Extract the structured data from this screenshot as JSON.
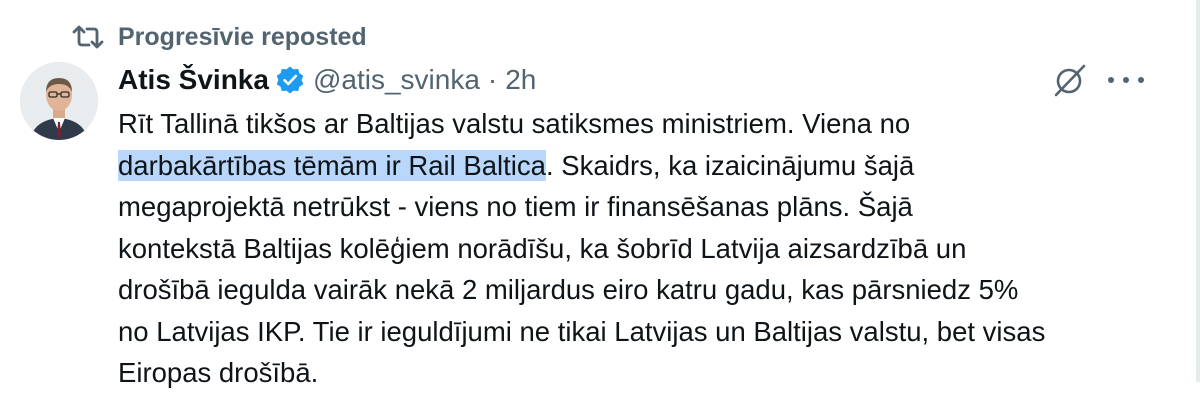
{
  "repost": {
    "icon": "repost-icon",
    "label": "Progresīvie reposted"
  },
  "author": {
    "avatar": "avatar",
    "name": "Atis Švinka",
    "verified_icon": "verified-badge-icon",
    "handle": "@atis_svinka",
    "separator": "·",
    "time": "2h"
  },
  "actions": {
    "grok_icon": "grok-icon",
    "more_icon": "more-options-icon"
  },
  "tweet": {
    "line1": "Rīt Tallinā tikšos ar Baltijas valstu satiksmes ministriem. Viena no",
    "line2_highlight": "darbakārtības tēmām ir Rail Baltica",
    "line2_rest": ". Skaidrs, ka izaicinājumu šajā",
    "line3": "megaprojektā netrūkst - viens no tiem ir finansēšanas plāns. Šajā",
    "line4": "kontekstā Baltijas kolēģiem norādīšu, ka šobrīd Latvija aizsardzībā un",
    "line5": "drošībā iegulda vairāk nekā 2 miljardus eiro katru gadu, kas pārsniedz 5%",
    "line6": "no Latvijas IKP. Tie ir ieguldījumi ne tikai Latvijas un Baltijas valstu, bet visas",
    "line7": "Eiropas drošībā."
  },
  "colors": {
    "text": "#0f1419",
    "secondary": "#536471",
    "verified": "#1d9bf0",
    "highlight": "#b9d6fb"
  }
}
